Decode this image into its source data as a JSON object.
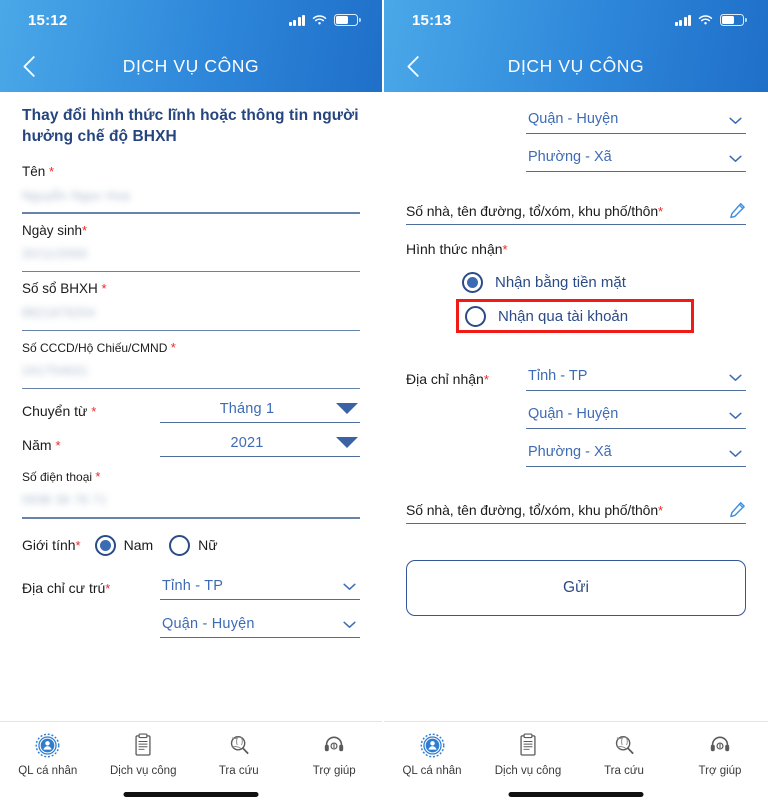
{
  "colors": {
    "header_from": "#4aa8e8",
    "header_to": "#1f6fc8",
    "accent_blue": "#3d6bb5",
    "title_blue": "#26457f",
    "required_red": "#e8292a",
    "highlight_red": "#f01b16",
    "underline": "#4c6d99"
  },
  "screens": [
    {
      "id": "screen-left",
      "status": {
        "time": "15:12",
        "signal_icon": "cellular-signal-icon",
        "wifi_icon": "wifi-icon",
        "battery_icon": "battery-icon"
      },
      "nav": {
        "back_icon": "chevron-left-icon",
        "title": "DỊCH VỤ CÔNG"
      },
      "form_title": "Thay đổi hình thức lĩnh hoặc thông tin người hưởng chế độ BHXH",
      "fields": [
        {
          "label": "Tên",
          "required": true,
          "value": "Nguyễn Ngọc Hoa",
          "redacted": true
        },
        {
          "label": "Ngày sinh",
          "required": true,
          "value": "20/11/2000",
          "redacted": true
        },
        {
          "label": "Số sổ BHXH",
          "required": true,
          "value": "8821879254",
          "redacted": true
        },
        {
          "label": "Số CCCD/Hộ Chiếu/CMND",
          "required": true,
          "value": "241754631",
          "redacted": true,
          "small_label": true
        }
      ],
      "selects": [
        {
          "label": "Chuyển từ",
          "required": true,
          "value": "Tháng 1",
          "caret": "caret-down-solid-icon"
        },
        {
          "label": "Năm",
          "required": true,
          "value": "2021",
          "caret": "caret-down-solid-icon"
        }
      ],
      "phone_field": {
        "label": "Số điện thoại",
        "required": true,
        "value": "0938 36 76 71",
        "redacted": true
      },
      "gender": {
        "label": "Giới tính",
        "required": true,
        "options": [
          {
            "label": "Nam",
            "selected": true
          },
          {
            "label": "Nữ",
            "selected": false
          }
        ]
      },
      "residence": {
        "label": "Địa chỉ cư trú",
        "required": true,
        "selects": [
          {
            "value": "Tỉnh - TP",
            "caret": "chevron-down-icon"
          },
          {
            "value": "Quận - Huyện",
            "caret": "chevron-down-icon"
          }
        ]
      },
      "tabs": [
        {
          "label": "QL cá nhân",
          "icon": "personal-badge-icon",
          "active": true
        },
        {
          "label": "Dịch vụ công",
          "icon": "document-clipboard-icon",
          "active": false
        },
        {
          "label": "Tra cứu",
          "icon": "magnifier-globe-icon",
          "active": false
        },
        {
          "label": "Trợ giúp",
          "icon": "headset-support-icon",
          "active": false
        }
      ]
    },
    {
      "id": "screen-right",
      "status": {
        "time": "15:13",
        "signal_icon": "cellular-signal-icon",
        "wifi_icon": "wifi-icon",
        "battery_icon": "battery-icon"
      },
      "nav": {
        "back_icon": "chevron-left-icon",
        "title": "DỊCH VỤ CÔNG"
      },
      "top_selects": [
        {
          "value": "Quận - Huyện",
          "caret": "chevron-down-icon"
        },
        {
          "value": "Phường - Xã",
          "caret": "chevron-down-icon"
        }
      ],
      "street_field_1": {
        "placeholder": "Số nhà, tên đường, tổ/xóm, khu phố/thôn",
        "required": true,
        "edit_icon": "pencil-edit-icon"
      },
      "receive_method": {
        "label": "Hình thức nhận",
        "required": true,
        "options": [
          {
            "label": "Nhận bằng tiền mặt",
            "selected": true,
            "highlighted": false
          },
          {
            "label": "Nhận qua tài khoản",
            "selected": false,
            "highlighted": true
          }
        ]
      },
      "receive_address": {
        "label": "Địa chỉ nhận",
        "required": true,
        "selects": [
          {
            "value": "Tỉnh - TP",
            "caret": "chevron-down-icon"
          },
          {
            "value": "Quận - Huyện",
            "caret": "chevron-down-icon"
          },
          {
            "value": "Phường - Xã",
            "caret": "chevron-down-icon"
          }
        ]
      },
      "street_field_2": {
        "placeholder": "Số nhà, tên đường, tổ/xóm, khu phố/thôn",
        "required": true,
        "edit_icon": "pencil-edit-icon"
      },
      "submit": {
        "label": "Gửi"
      },
      "tabs": [
        {
          "label": "QL cá nhân",
          "icon": "personal-badge-icon",
          "active": true
        },
        {
          "label": "Dịch vụ công",
          "icon": "document-clipboard-icon",
          "active": false
        },
        {
          "label": "Tra cứu",
          "icon": "magnifier-globe-icon",
          "active": false
        },
        {
          "label": "Trợ giúp",
          "icon": "headset-support-icon",
          "active": false
        }
      ]
    }
  ]
}
